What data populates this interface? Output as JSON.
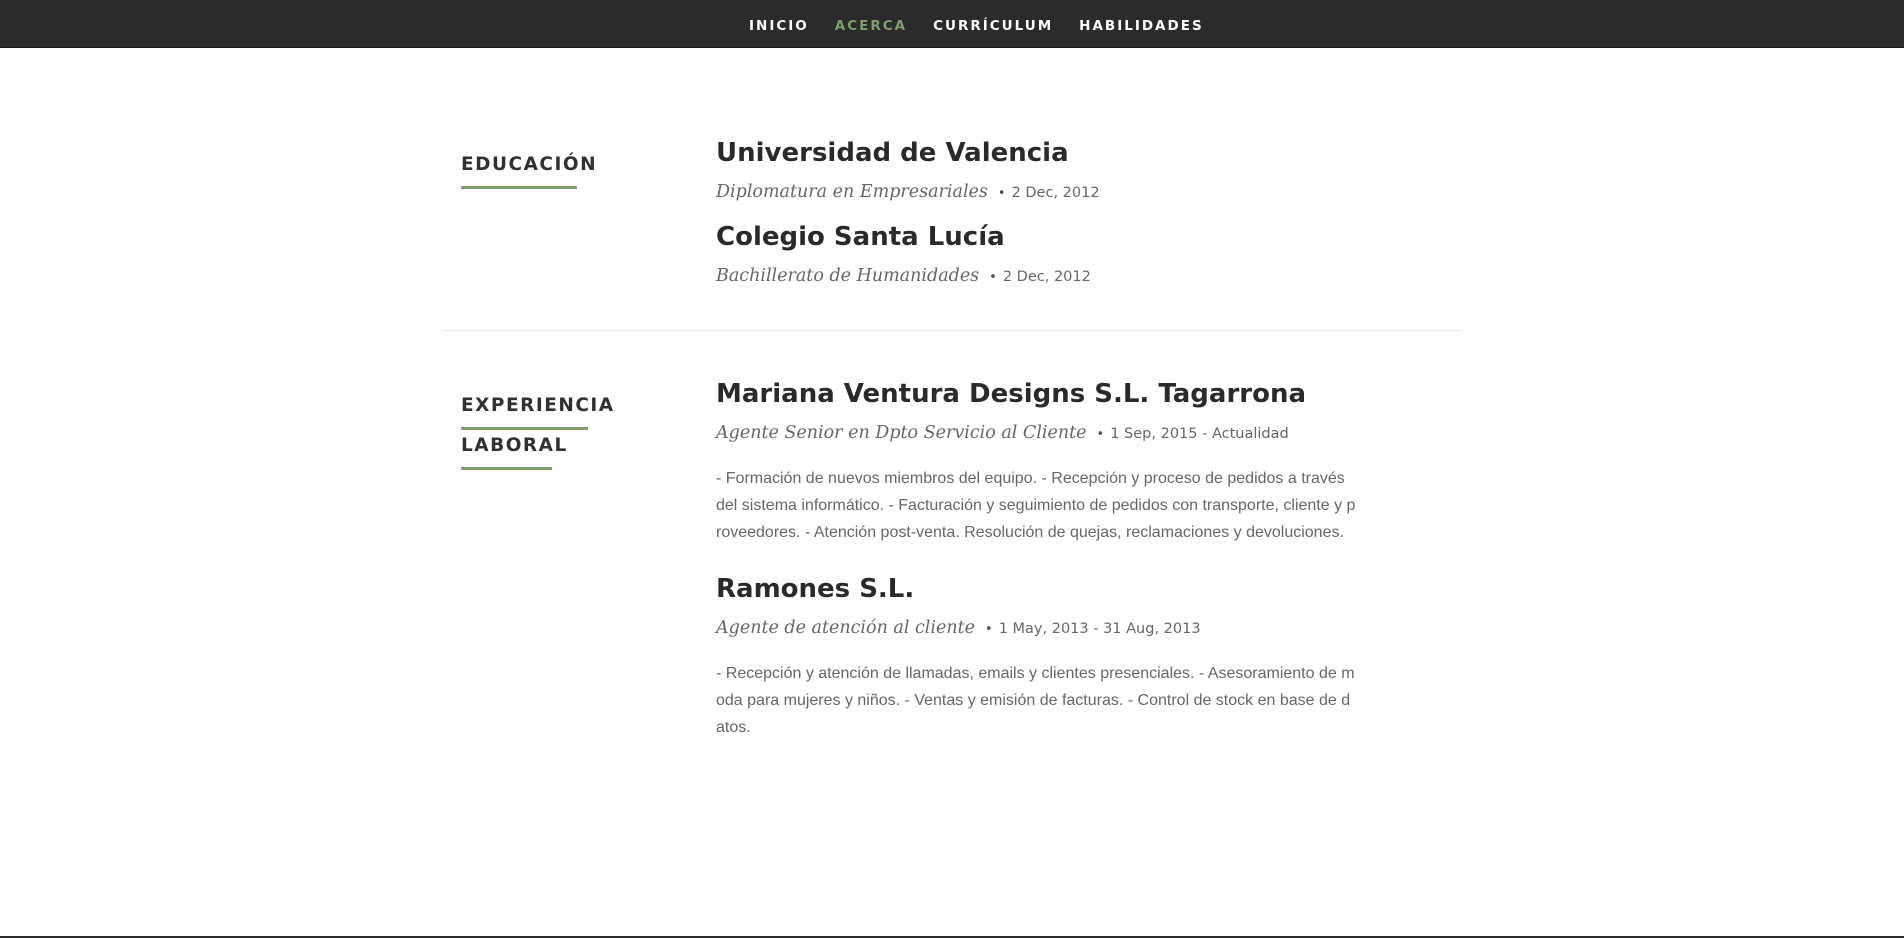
{
  "nav": {
    "items": [
      {
        "label": "INICIO",
        "active": false
      },
      {
        "label": "ACERCA",
        "active": true
      },
      {
        "label": "CURRÍCULUM",
        "active": false
      },
      {
        "label": "HABILIDADES",
        "active": false
      }
    ]
  },
  "education": {
    "heading": "EDUCACIÓN",
    "entries": [
      {
        "title": "Universidad de Valencia",
        "role": "Diplomatura en Empresariales",
        "date": "2 Dec, 2012"
      },
      {
        "title": "Colegio Santa Lucía",
        "role": "Bachillerato de Humanidades",
        "date": "2 Dec, 2012"
      }
    ]
  },
  "work": {
    "heading_line1": "EXPERIENCIA",
    "heading_line2": "LABORAL",
    "entries": [
      {
        "title": "Mariana Ventura Designs S.L. Tagarrona",
        "role": "Agente Senior en Dpto Servicio al Cliente",
        "date": "1 Sep, 2015 - Actualidad",
        "description": "- Formación de nuevos miembros del equipo. - Recepción y proceso de pedidos a través del sistema informático. - Facturación y seguimiento de pedidos con transporte, cliente y proveedores. - Atención post-venta. Resolución de quejas, reclamaciones y devoluciones."
      },
      {
        "title": "Ramones S.L.",
        "role": "Agente de atención al cliente",
        "date": "1 May, 2013 - 31 Aug, 2013",
        "description": "- Recepción y atención de llamadas, emails y clientes presenciales. - Asesoramiento de moda para mujeres y niños. - Ventas y emisión de facturas. - Control de stock en base de datos."
      }
    ]
  },
  "colors": {
    "accent": "#7c9f6c",
    "nav_background": "#2b2b2b",
    "text": "#313131",
    "muted": "#666666"
  }
}
